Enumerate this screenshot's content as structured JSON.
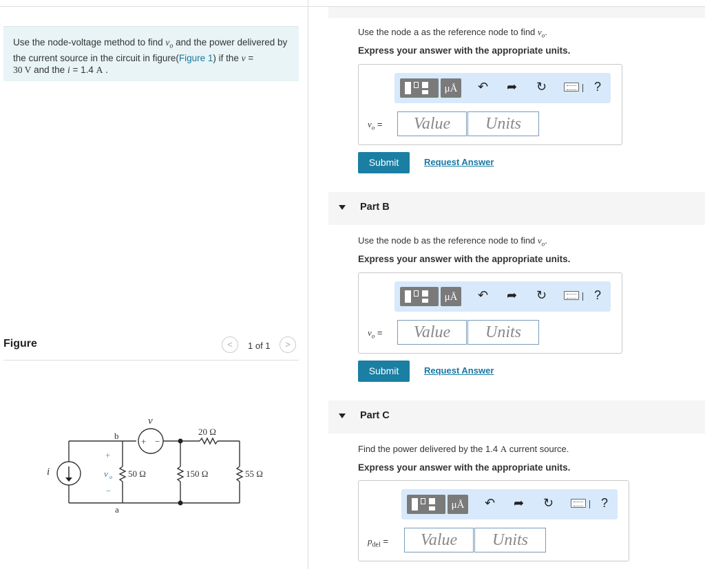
{
  "problem": {
    "text_1": "Use the node-voltage method to find ",
    "var_vo": "v",
    "var_vo_sub": "o",
    "text_2": " and the power delivered by the current source in the circuit in figure(",
    "figure_link": "Figure 1",
    "text_3": ") if the ",
    "var_v": "v",
    "text_4": " = ",
    "v_value": "30 V",
    "text_5": " and the ",
    "var_i": "i",
    "text_6": " = 1.4 ",
    "i_unit": "A",
    "text_7": " ."
  },
  "figure": {
    "title": "Figure",
    "counter": "1 of 1",
    "prev": "<",
    "next": ">"
  },
  "circuit": {
    "label_i": "i",
    "label_v": "v",
    "label_b": "b",
    "label_a": "a",
    "label_vo": "v",
    "label_vo_sub": "o",
    "plus_sign": "+",
    "minus_sign": "−",
    "r1": "50 Ω",
    "r2": "150 Ω",
    "r3": "55 Ω",
    "r4": "20 Ω",
    "src_plus": "+",
    "src_minus": "−"
  },
  "toolbar": {
    "unit_glyph": "μÅ",
    "undo": "↶",
    "redo": "➦",
    "reset": "↻",
    "help": "?"
  },
  "part_a": {
    "instruction_pre": "Use the node a as the reference node to find ",
    "instruction_var": "v",
    "instruction_sub": "o",
    "instruction_post": ".",
    "units_note": "Express your answer with the appropriate units.",
    "var_label": "v",
    "var_sub": "o",
    "eq": " =",
    "value_placeholder": "Value",
    "units_placeholder": "Units",
    "submit": "Submit",
    "request": "Request Answer"
  },
  "part_b": {
    "title": "Part B",
    "instruction_pre": "Use the node b as the reference node to find ",
    "instruction_var": "v",
    "instruction_sub": "o",
    "instruction_post": ".",
    "units_note": "Express your answer with the appropriate units.",
    "var_label": "v",
    "var_sub": "o",
    "eq": " =",
    "value_placeholder": "Value",
    "units_placeholder": "Units",
    "submit": "Submit",
    "request": "Request Answer"
  },
  "part_c": {
    "title": "Part C",
    "instruction_pre": "Find the power delivered by the 1.4 ",
    "instruction_unit": "A",
    "instruction_post": " current source.",
    "units_note": "Express your answer with the appropriate units.",
    "var_label": "p",
    "var_sub": "del",
    "eq": " =",
    "value_placeholder": "Value",
    "units_placeholder": "Units"
  }
}
